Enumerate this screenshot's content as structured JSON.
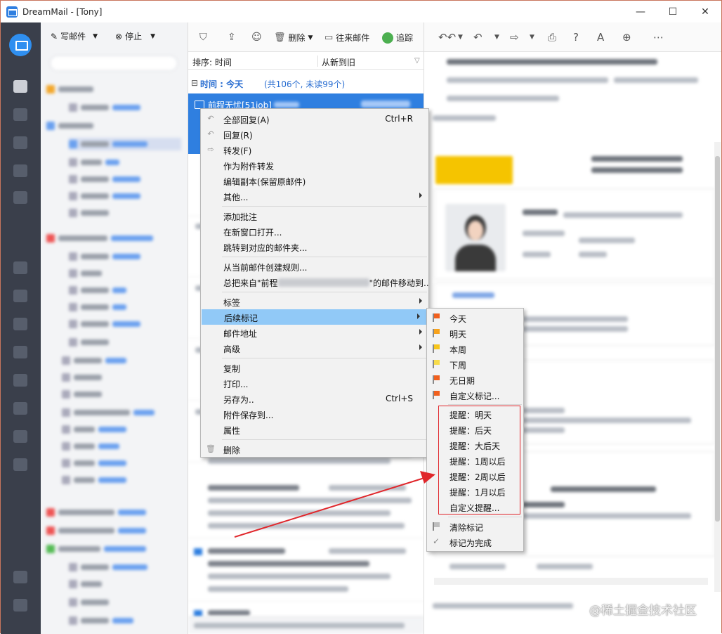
{
  "window": {
    "title": "DreamMail - [Tony]",
    "minimize": "—",
    "maximize": "☐",
    "close": "✕"
  },
  "toolbar": {
    "compose": "写邮件",
    "stop": "停止",
    "delete": "删除",
    "contacts_mail": "往来邮件",
    "track": "追踪"
  },
  "list": {
    "sort_label": "排序: 时间",
    "sort_order": "从新到旧",
    "group_prefix": "⊟",
    "group_title": "时间 : 今天",
    "group_count": "(共106个, 未读99个)",
    "selected_sender": "前程无忧[51job]"
  },
  "context_menu": {
    "items": [
      {
        "label": "全部回复(A)",
        "shortcut": "Ctrl+R"
      },
      {
        "label": "回复(R)",
        "shortcut": ""
      },
      {
        "label": "转发(F)",
        "shortcut": ""
      },
      {
        "label": "作为附件转发",
        "shortcut": ""
      },
      {
        "label": "编辑副本(保留原邮件)",
        "shortcut": ""
      },
      {
        "label": "其他...",
        "shortcut": ""
      },
      {
        "label": "添加批注",
        "shortcut": ""
      },
      {
        "label": "在新窗口打开...",
        "shortcut": ""
      },
      {
        "label": "跳转到对应的邮件夹...",
        "shortcut": ""
      },
      {
        "label": "从当前邮件创建规则...",
        "shortcut": ""
      },
      {
        "label_prefix": "总把来自\"前程",
        "label_suffix": "\"的邮件移动到..",
        "shortcut": ""
      },
      {
        "label": "标签",
        "shortcut": ""
      },
      {
        "label": "后续标记",
        "shortcut": ""
      },
      {
        "label": "邮件地址",
        "shortcut": ""
      },
      {
        "label": "高级",
        "shortcut": ""
      },
      {
        "label": "复制",
        "shortcut": ""
      },
      {
        "label": "打印...",
        "shortcut": ""
      },
      {
        "label": "另存为..",
        "shortcut": "Ctrl+S"
      },
      {
        "label": "附件保存到...",
        "shortcut": ""
      },
      {
        "label": "属性",
        "shortcut": ""
      },
      {
        "label": "删除",
        "shortcut": ""
      }
    ]
  },
  "followup_menu": {
    "flags": [
      {
        "label": "今天",
        "color": "#f0601e"
      },
      {
        "label": "明天",
        "color": "#f7a21b"
      },
      {
        "label": "本周",
        "color": "#f7c51b"
      },
      {
        "label": "下周",
        "color": "#f7dc4a"
      },
      {
        "label": "无日期",
        "color": "#f0601e"
      },
      {
        "label": "自定义标记...",
        "color": "#f0601e"
      }
    ],
    "reminders": [
      {
        "label": "提醒：明天"
      },
      {
        "label": "提醒：后天"
      },
      {
        "label": "提醒：大后天"
      },
      {
        "label": "提醒：1周以后"
      },
      {
        "label": "提醒：2周以后"
      },
      {
        "label": "提醒：1月以后"
      },
      {
        "label": "自定义提醒..."
      }
    ],
    "clear": "清除标记",
    "complete": "标记为完成"
  },
  "annotation": {
    "highlight_color": "#e0262b"
  },
  "watermark": "@稀土掘金技术社区"
}
